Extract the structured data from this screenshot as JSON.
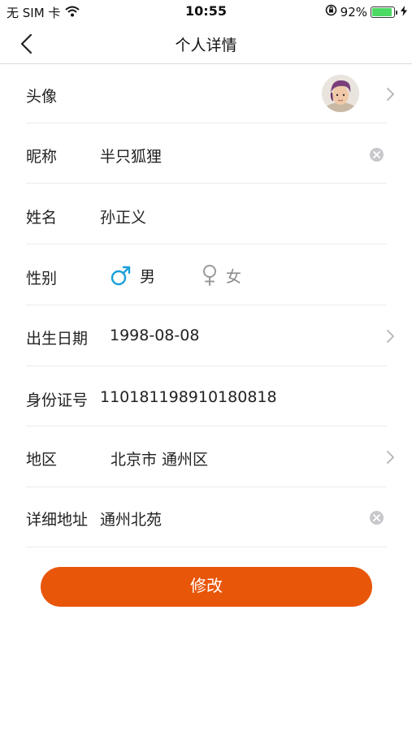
{
  "status_bar": {
    "carrier": "无 SIM 卡",
    "time": "10:55",
    "battery_percent": "92%",
    "battery_level": 0.92,
    "icons": [
      "wifi-icon",
      "orientation-lock-icon",
      "battery-icon",
      "charging-icon"
    ]
  },
  "nav": {
    "title": "个人详情",
    "back_icon": "chevron-left-icon"
  },
  "form": {
    "avatar": {
      "label": "头像"
    },
    "nickname": {
      "label": "昵称",
      "value": "半只狐狸"
    },
    "name": {
      "label": "姓名",
      "value": "孙正义"
    },
    "gender": {
      "label": "性别",
      "male": "男",
      "female": "女",
      "selected": "male"
    },
    "birthday": {
      "label": "出生日期",
      "value": "1998-08-08"
    },
    "id_number": {
      "label": "身份证号",
      "value": "110181198910180818"
    },
    "region": {
      "label": "地区",
      "value": "北京市 通州区"
    },
    "address": {
      "label": "详细地址",
      "value": "通州北苑"
    }
  },
  "submit_label": "修改",
  "colors": {
    "accent": "#e8560a",
    "male_selected": "#1aa0d8",
    "female_unselected": "#999999",
    "battery_fill": "#4cd964"
  }
}
